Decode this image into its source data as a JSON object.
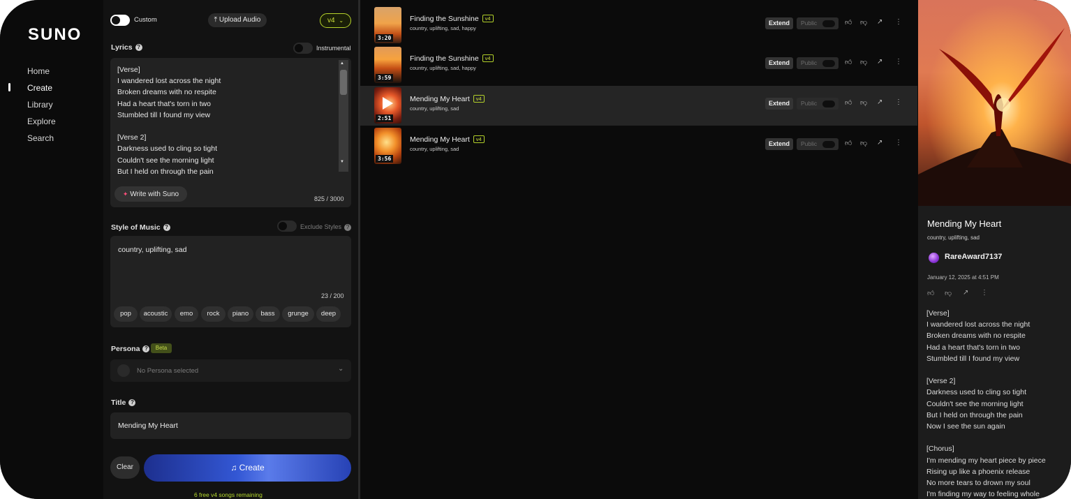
{
  "nav": {
    "logo": "SUNO",
    "items": [
      "Home",
      "Create",
      "Library",
      "Explore",
      "Search"
    ],
    "active": "Create"
  },
  "create": {
    "custom_label": "Custom",
    "custom_on": true,
    "upload_label": "Upload Audio",
    "version_label": "v4",
    "lyrics_label": "Lyrics",
    "instrumental_label": "Instrumental",
    "instrumental_on": false,
    "lyrics_text": "[Verse]\nI wandered lost across the night\nBroken dreams with no respite\nHad a heart that's torn in two\nStumbled till I found my view\n\n[Verse 2]\nDarkness used to cling so tight\nCouldn't see the morning light\nBut I held on through the pain",
    "write_with_suno": "Write with Suno",
    "lyrics_count": "825 / 3000",
    "style_label": "Style of Music",
    "exclude_styles_label": "Exclude Styles",
    "style_value": "country, uplifting, sad",
    "style_count": "23 / 200",
    "style_chips": [
      "pop",
      "acoustic",
      "emo",
      "rock",
      "piano",
      "bass",
      "grunge",
      "deep"
    ],
    "persona_label": "Persona",
    "beta_label": "Beta",
    "persona_placeholder": "No Persona selected",
    "title_label": "Title",
    "title_value": "Mending My Heart",
    "clear_label": "Clear",
    "create_label": "Create",
    "remaining": "6 free v4 songs remaining"
  },
  "songs": [
    {
      "title": "Finding the Sunshine",
      "tag": "v4",
      "styles": "country, uplifting, sad, happy",
      "duration": "3:20",
      "extend": "Extend",
      "public": "Public",
      "active": false
    },
    {
      "title": "Finding the Sunshine",
      "tag": "v4",
      "styles": "country, uplifting, sad, happy",
      "duration": "3:59",
      "extend": "Extend",
      "public": "Public",
      "active": false
    },
    {
      "title": "Mending My Heart",
      "tag": "v4",
      "styles": "country, uplifting, sad",
      "duration": "2:51",
      "extend": "Extend",
      "public": "Public",
      "active": true
    },
    {
      "title": "Mending My Heart",
      "tag": "v4",
      "styles": "country, uplifting, sad",
      "duration": "3:56",
      "extend": "Extend",
      "public": "Public",
      "active": false
    }
  ],
  "detail": {
    "title": "Mending My Heart",
    "styles": "country, uplifting, sad",
    "user": "RareAward7137",
    "date": "January 12, 2025 at 4:51 PM",
    "lyrics": "[Verse]\nI wandered lost across the night\nBroken dreams with no respite\nHad a heart that's torn in two\nStumbled till I found my view\n\n[Verse 2]\nDarkness used to cling so tight\nCouldn't see the morning light\nBut I held on through the pain\nNow I see the sun again\n\n[Chorus]\nI'm mending my heart piece by piece\nRising up like a phoenix release\nNo more tears to drown my soul\nI'm finding my way to feeling whole"
  },
  "icons": {
    "like": "thumbs-up-icon",
    "dislike": "thumbs-down-icon",
    "share": "share-icon",
    "more": "more-vertical-icon",
    "play": "play-icon",
    "sparkle": "sparkle-icon",
    "upload": "upload-icon",
    "music": "music-note-icon",
    "chevron": "chevron-down-icon",
    "help": "help-icon"
  },
  "colors": {
    "accent_green": "#cde03a",
    "create_gradient_start": "#1d2f8e",
    "create_gradient_mid": "#5a7bea",
    "background": "#0b0b0b",
    "panel": "#121212"
  }
}
